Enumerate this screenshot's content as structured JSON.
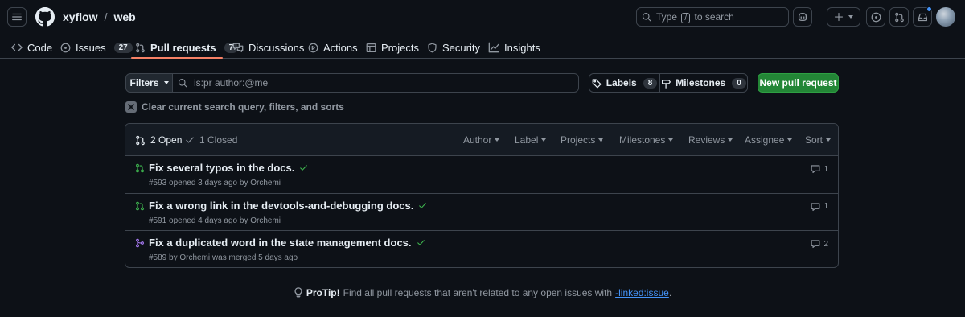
{
  "header": {
    "owner": "xyflow",
    "separator": "/",
    "repo": "web",
    "search_prefix": "Type",
    "search_key": "/",
    "search_suffix": "to search"
  },
  "reponav": {
    "code": "Code",
    "issues": "Issues",
    "issues_count": "27",
    "pulls": "Pull requests",
    "pulls_count": "7",
    "discussions": "Discussions",
    "actions": "Actions",
    "projects": "Projects",
    "security": "Security",
    "insights": "Insights"
  },
  "toolbar": {
    "filters_label": "Filters",
    "query": "is:pr author:@me",
    "labels_label": "Labels",
    "labels_count": "8",
    "milestones_label": "Milestones",
    "milestones_count": "0",
    "new_pr_label": "New pull request",
    "clear_label": "Clear current search query, filters, and sorts"
  },
  "list": {
    "open_label": "2 Open",
    "closed_label": "1 Closed",
    "selects": [
      "Author",
      "Label",
      "Projects",
      "Milestones",
      "Reviews",
      "Assignee",
      "Sort"
    ],
    "items": [
      {
        "title": "Fix several typos in the docs.",
        "meta": "#593 opened 3 days ago by Orchemi",
        "comments": "1",
        "state": "open"
      },
      {
        "title": "Fix a wrong link in the devtools-and-debugging docs.",
        "meta": "#591 opened 4 days ago by Orchemi",
        "comments": "1",
        "state": "open"
      },
      {
        "title": "Fix a duplicated word in the state management docs.",
        "meta": "#589 by Orchemi was merged 5 days ago",
        "comments": "2",
        "state": "merged"
      }
    ]
  },
  "protip": {
    "bold": "ProTip!",
    "text": "Find all pull requests that aren't related to any open issues with",
    "link": "-linked:issue",
    "end": "."
  },
  "colors": {
    "open": "#3fb950",
    "merged": "#ab7df8",
    "accent": "#f78166",
    "primary": "#238636",
    "link": "#4493f8"
  }
}
